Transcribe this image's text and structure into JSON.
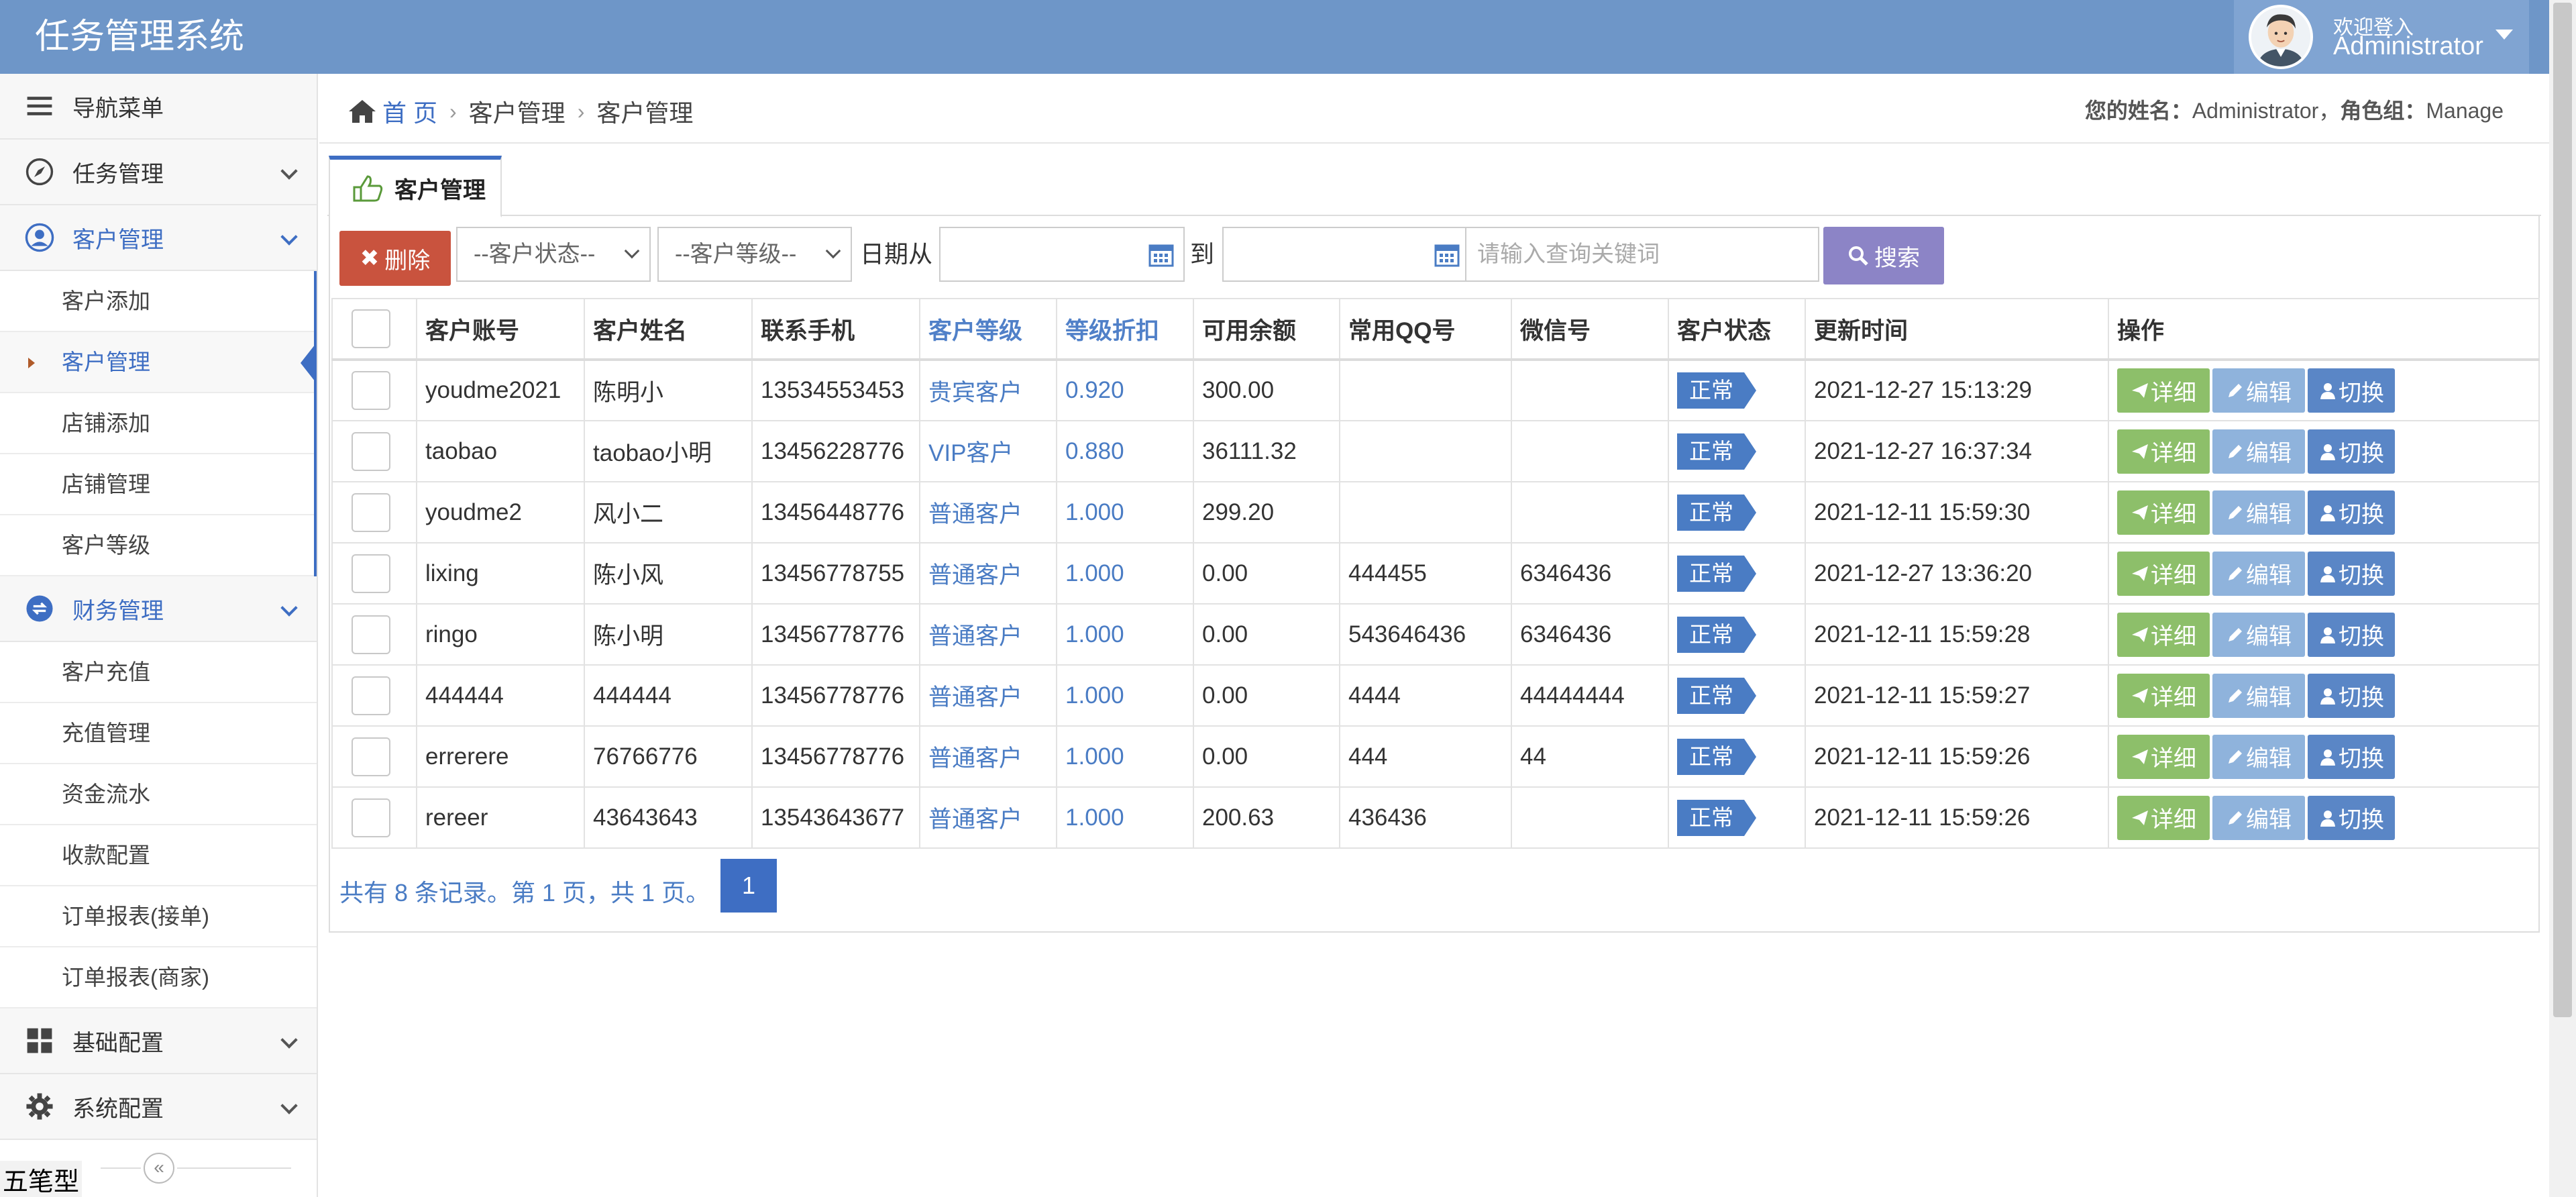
{
  "app": {
    "title": "任务管理系统"
  },
  "user": {
    "welcome": "欢迎登入",
    "name": "Administrator"
  },
  "sidebar": {
    "nav_menu": "导航菜单",
    "task_mgmt": "任务管理",
    "customer_mgmt": "客户管理",
    "customer_items": [
      "客户添加",
      "客户管理",
      "店铺添加",
      "店铺管理",
      "客户等级"
    ],
    "finance_mgmt": "财务管理",
    "finance_items": [
      "客户充值",
      "充值管理",
      "资金流水",
      "收款配置",
      "订单报表(接单)",
      "订单报表(商家)"
    ],
    "basic_config": "基础配置",
    "system_config": "系统配置",
    "ime": "五笔型"
  },
  "breadcrumb": {
    "home": "首 页",
    "level1": "客户管理",
    "level2": "客户管理"
  },
  "user_info": {
    "name_label": "您的姓名：",
    "name": "Administrator",
    "role_label": "角色组：",
    "role": "Manage"
  },
  "tab": {
    "label": "客户管理"
  },
  "toolbar": {
    "delete": "删除",
    "status_select": "--客户状态--",
    "level_select": "--客户等级--",
    "date_from": "日期从",
    "date_to": "到",
    "search_placeholder": "请输入查询关键词",
    "search": "搜索"
  },
  "table": {
    "headers": [
      "客户账号",
      "客户姓名",
      "联系手机",
      "客户等级",
      "等级折扣",
      "可用余额",
      "常用QQ号",
      "微信号",
      "客户状态",
      "更新时间",
      "操作"
    ],
    "rows": [
      {
        "account": "youdme2021",
        "name": "陈明小",
        "phone": "13534553453",
        "level": "贵宾客户",
        "discount": "0.920",
        "balance": "300.00",
        "qq": "",
        "wechat": "",
        "status": "正常",
        "updated": "2021-12-27 15:13:29"
      },
      {
        "account": "taobao",
        "name": "taobao小明",
        "phone": "13456228776",
        "level": "VIP客户",
        "discount": "0.880",
        "balance": "36111.32",
        "qq": "",
        "wechat": "",
        "status": "正常",
        "updated": "2021-12-27 16:37:34"
      },
      {
        "account": "youdme2",
        "name": "风小二",
        "phone": "13456448776",
        "level": "普通客户",
        "discount": "1.000",
        "balance": "299.20",
        "qq": "",
        "wechat": "",
        "status": "正常",
        "updated": "2021-12-11 15:59:30"
      },
      {
        "account": "lixing",
        "name": "陈小风",
        "phone": "13456778755",
        "level": "普通客户",
        "discount": "1.000",
        "balance": "0.00",
        "qq": "444455",
        "wechat": "6346436",
        "status": "正常",
        "updated": "2021-12-27 13:36:20"
      },
      {
        "account": "ringo",
        "name": "陈小明",
        "phone": "13456778776",
        "level": "普通客户",
        "discount": "1.000",
        "balance": "0.00",
        "qq": "543646436",
        "wechat": "6346436",
        "status": "正常",
        "updated": "2021-12-11 15:59:28"
      },
      {
        "account": "444444",
        "name": "444444",
        "phone": "13456778776",
        "level": "普通客户",
        "discount": "1.000",
        "balance": "0.00",
        "qq": "4444",
        "wechat": "44444444",
        "status": "正常",
        "updated": "2021-12-11 15:59:27"
      },
      {
        "account": "errerere",
        "name": "76766776",
        "phone": "13456778776",
        "level": "普通客户",
        "discount": "1.000",
        "balance": "0.00",
        "qq": "444",
        "wechat": "44",
        "status": "正常",
        "updated": "2021-12-11 15:59:26"
      },
      {
        "account": "rereer",
        "name": "43643643",
        "phone": "13543643677",
        "level": "普通客户",
        "discount": "1.000",
        "balance": "200.63",
        "qq": "436436",
        "wechat": "",
        "status": "正常",
        "updated": "2021-12-11 15:59:26"
      }
    ],
    "actions": {
      "detail": "详细",
      "edit": "编辑",
      "switch": "切换"
    }
  },
  "pagination": {
    "summary": "共有 8 条记录。第 1 页，共 1 页。",
    "current": "1"
  },
  "colors": {
    "header": "#6e96c8",
    "accent": "#3e6ec3",
    "delete": "#c9533e",
    "search": "#8c84c6",
    "detail": "#8dbf6a",
    "edit": "#8fb3dc",
    "switch": "#5a86c6"
  }
}
